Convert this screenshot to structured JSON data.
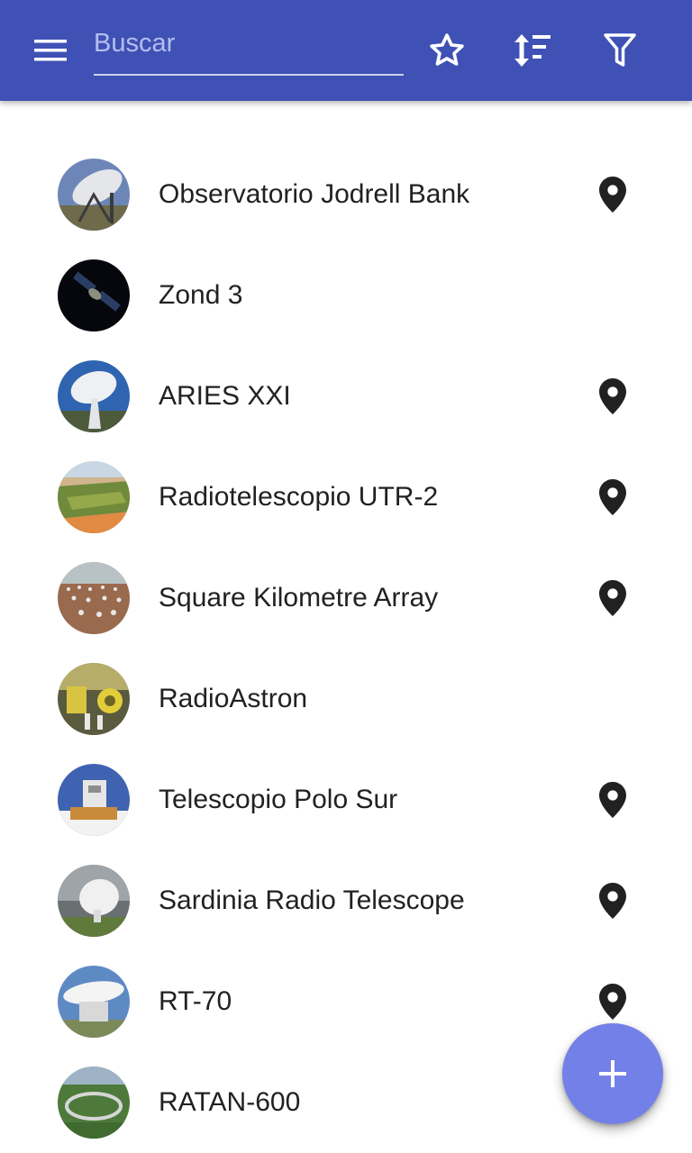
{
  "header": {
    "search_placeholder": "Buscar",
    "search_value": "",
    "background_color": "#3f51b5",
    "icons": [
      "menu-icon",
      "star-icon",
      "sort-icon",
      "filter-icon"
    ]
  },
  "items": [
    {
      "label": "Observatorio Jodrell Bank",
      "has_location": true
    },
    {
      "label": "Zond 3",
      "has_location": false
    },
    {
      "label": "ARIES XXI",
      "has_location": true
    },
    {
      "label": "Radiotelescopio UTR-2",
      "has_location": true
    },
    {
      "label": "Square Kilometre Array",
      "has_location": true
    },
    {
      "label": "RadioAstron",
      "has_location": false
    },
    {
      "label": "Telescopio Polo Sur",
      "has_location": true
    },
    {
      "label": "Sardinia Radio Telescope",
      "has_location": true
    },
    {
      "label": "RT-70",
      "has_location": true
    },
    {
      "label": "RATAN-600",
      "has_location": false
    }
  ],
  "fab": {
    "icon": "add-icon",
    "color": "#7280e8"
  }
}
